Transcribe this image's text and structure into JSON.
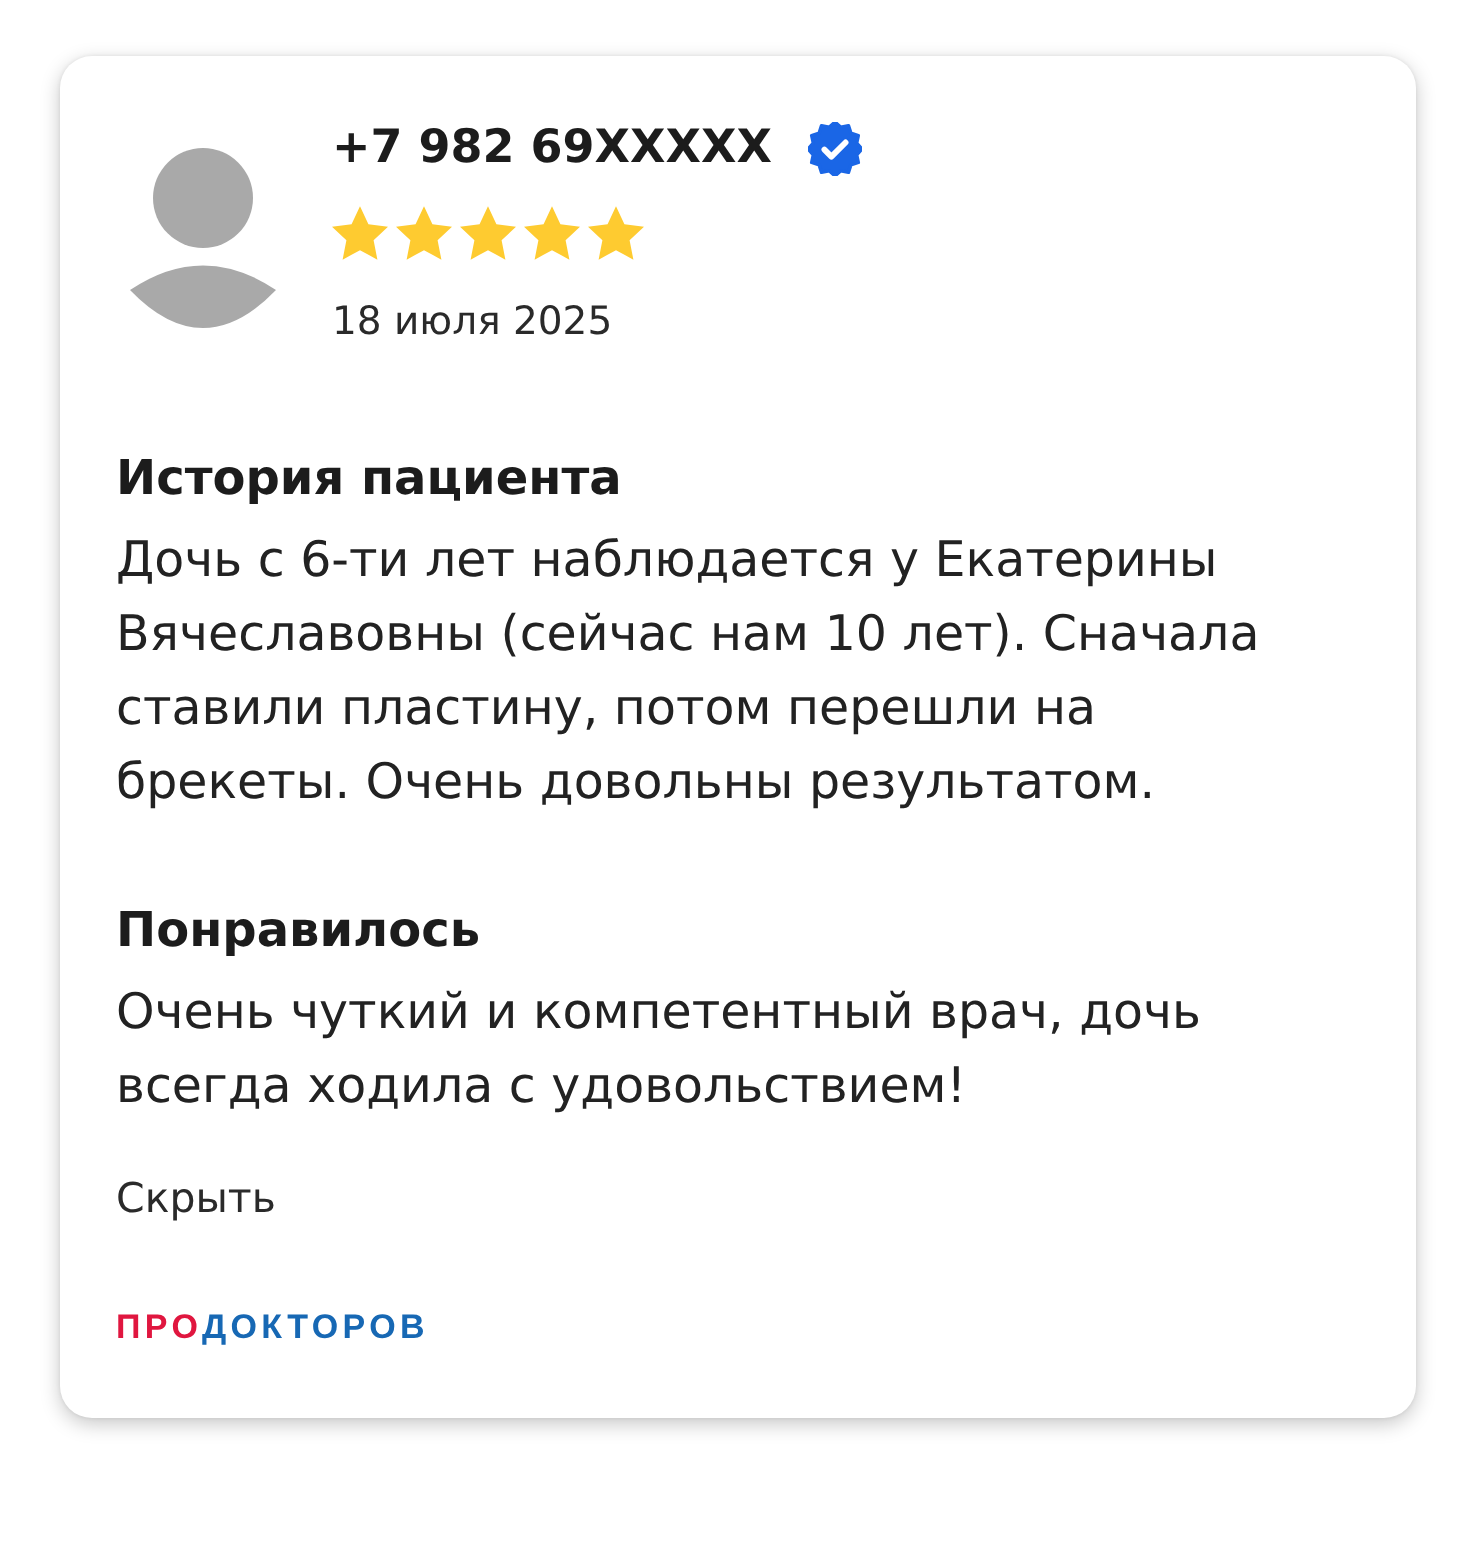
{
  "review": {
    "author": "+7 982 69XXXXX",
    "verified": true,
    "stars": 5,
    "date": "18 июля 2025"
  },
  "sections": [
    {
      "title": "История пациента",
      "text": "Дочь с 6-ти лет наблюдается у Екатерины Вячеславовны (сейчас нам 10 лет). Сначала ставили пластину, потом перешли на брекеты. Очень довольны результатом."
    },
    {
      "title": "Понравилось",
      "text": "Очень чуткий и компетентный врач, дочь всегда ходила с удовольствием!"
    }
  ],
  "hide_link": "Скрыть",
  "logo": [
    {
      "text": "ПРО",
      "color": "#e0163f"
    },
    {
      "text": "ДОКТОРОВ",
      "color": "#1768b4"
    }
  ]
}
